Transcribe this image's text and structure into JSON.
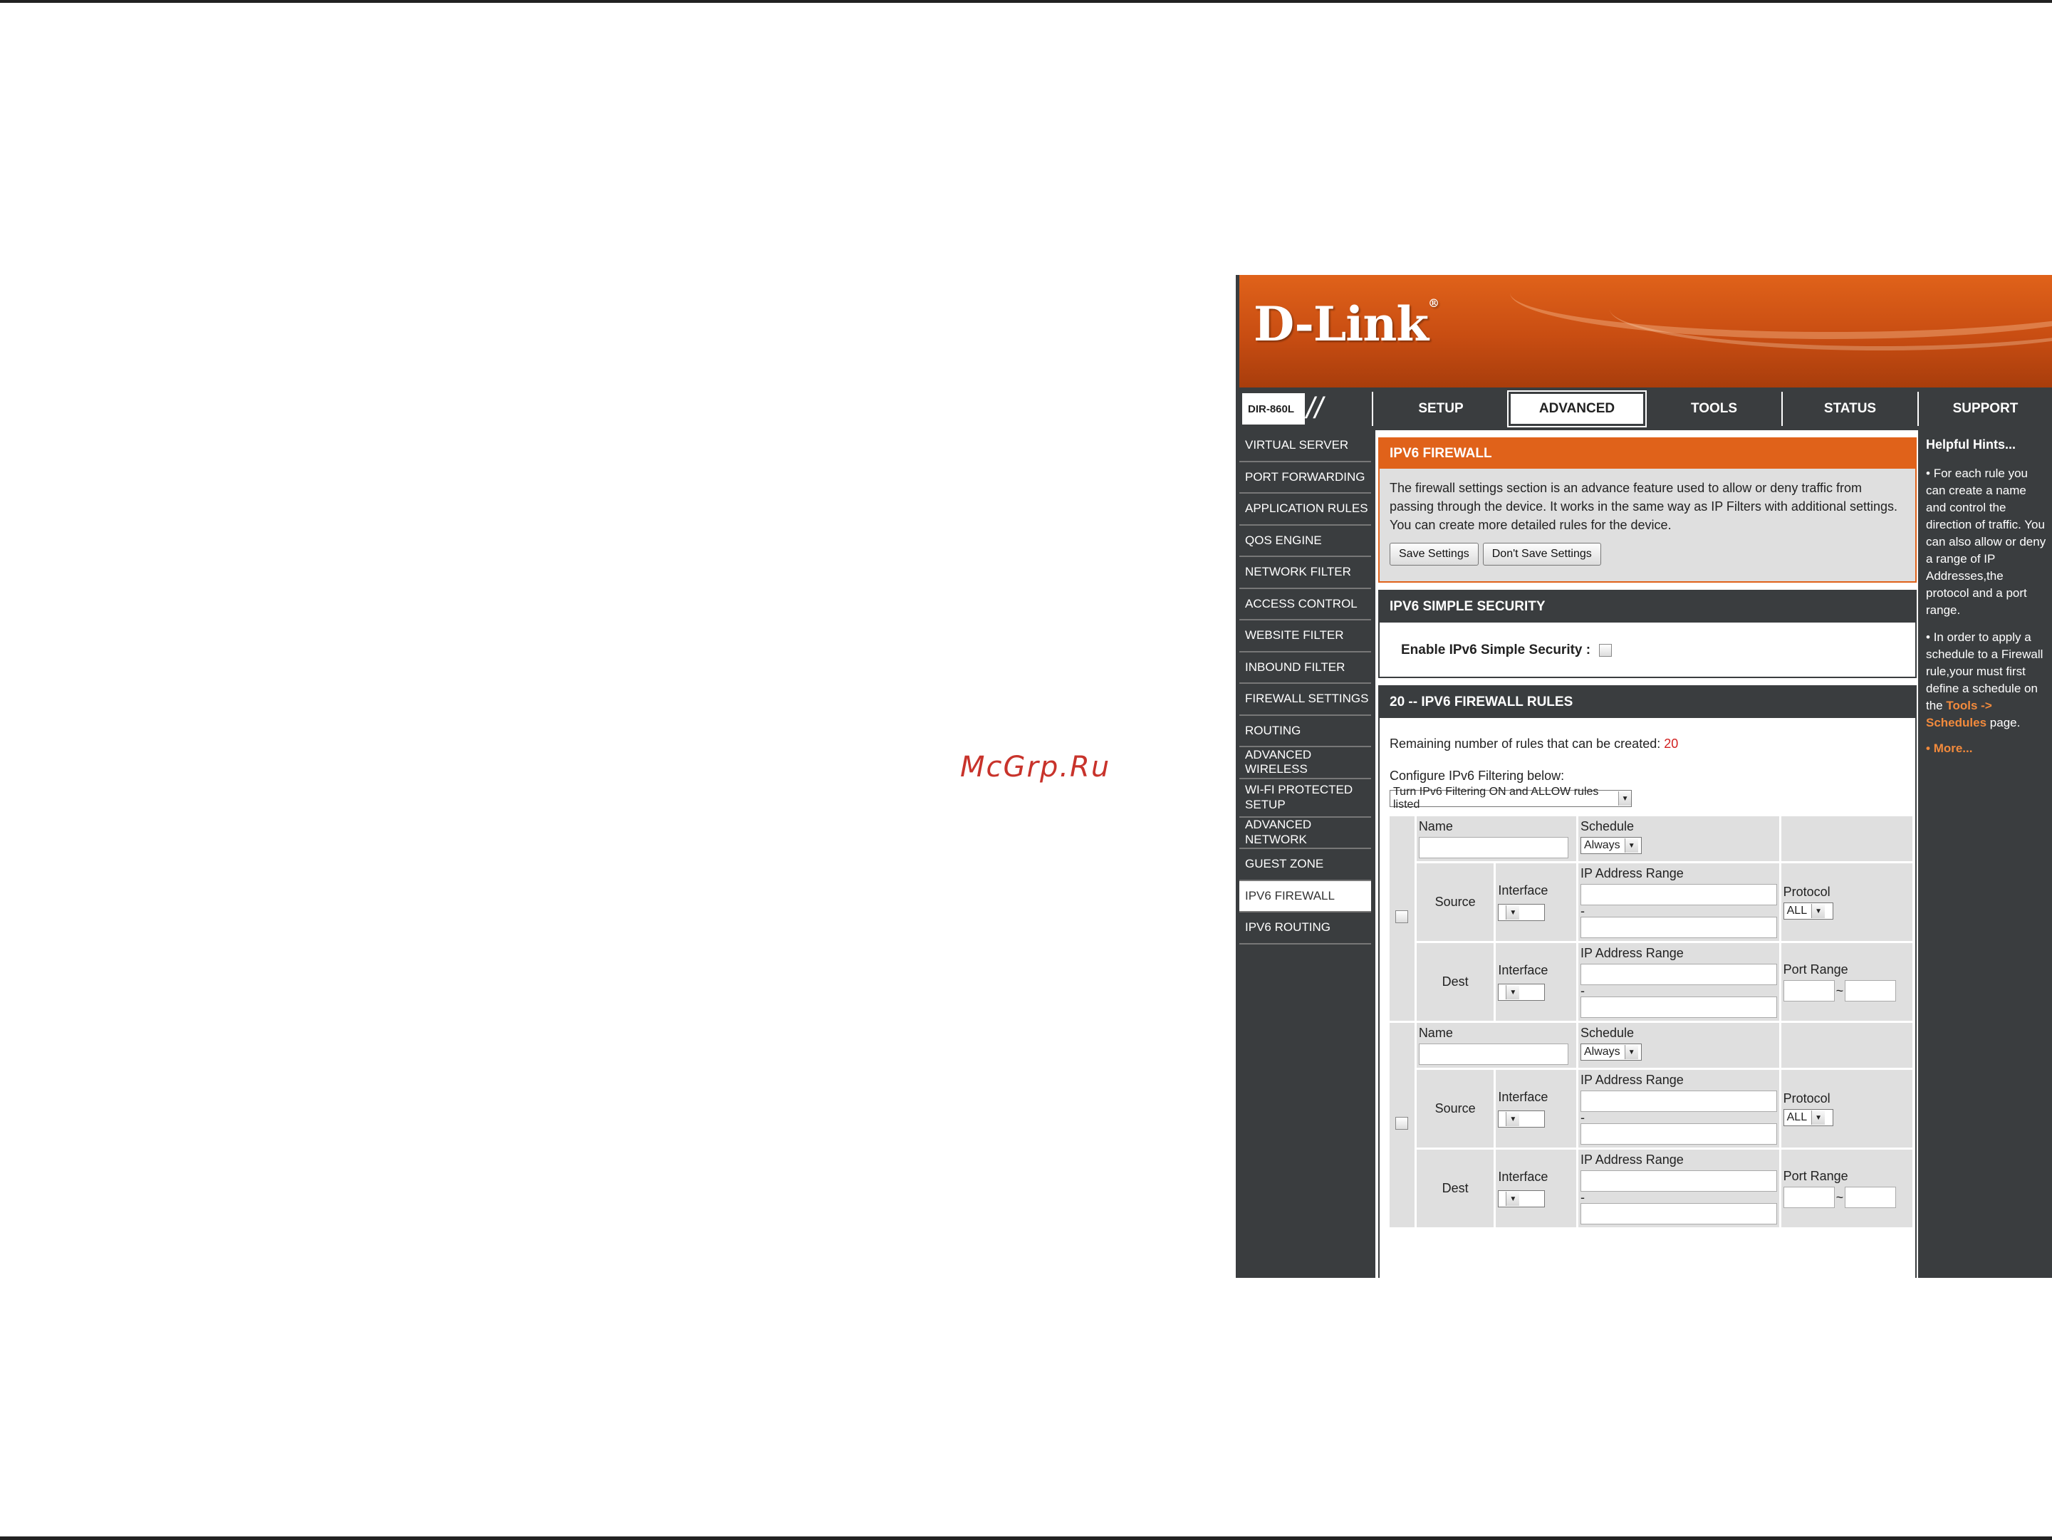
{
  "watermark": "McGrp.Ru",
  "brand": {
    "logo": "D-Link",
    "registered": "®",
    "model": "DIR-860L",
    "accent": "#e0621a"
  },
  "nav": {
    "tabs": [
      "SETUP",
      "ADVANCED",
      "TOOLS",
      "STATUS",
      "SUPPORT"
    ],
    "active": "ADVANCED"
  },
  "sidebar": {
    "items": [
      "VIRTUAL SERVER",
      "PORT FORWARDING",
      "APPLICATION RULES",
      "QOS ENGINE",
      "NETWORK FILTER",
      "ACCESS CONTROL",
      "WEBSITE FILTER",
      "INBOUND FILTER",
      "FIREWALL SETTINGS",
      "ROUTING",
      "ADVANCED WIRELESS",
      "WI-FI PROTECTED SETUP",
      "ADVANCED NETWORK",
      "GUEST ZONE",
      "IPV6 FIREWALL",
      "IPV6 ROUTING"
    ],
    "active": "IPV6 FIREWALL"
  },
  "firewall": {
    "title": "IPV6 FIREWALL",
    "description": "The firewall settings section is an advance feature used to allow or deny traffic from passing through the device. It works in the same way as IP Filters with additional settings. You can create more detailed rules for the device.",
    "save_label": "Save Settings",
    "dont_save_label": "Don't Save Settings"
  },
  "simple_security": {
    "title": "IPV6 SIMPLE SECURITY",
    "label": "Enable IPv6 Simple Security :",
    "checked": false
  },
  "rules": {
    "title": "20 -- IPV6 FIREWALL RULES",
    "remaining_label": "Remaining number of rules that can be created:",
    "remaining_value": "20",
    "configure_label": "Configure IPv6 Filtering below:",
    "configure_value": "Turn IPv6 Filtering ON and ALLOW rules listed",
    "labels": {
      "name": "Name",
      "schedule": "Schedule",
      "source": "Source",
      "dest": "Dest",
      "interface": "Interface",
      "ip_range": "IP Address Range",
      "protocol": "Protocol",
      "port_range": "Port Range",
      "dash": "-",
      "tilde": "~"
    },
    "schedule_value": "Always",
    "protocol_value": "ALL"
  },
  "hints": {
    "title": "Helpful Hints...",
    "hint1": "For each rule you can create a name and control the direction of traffic. You can also allow or deny a range of IP Addresses,the protocol and a port range.",
    "hint2_text": "In order to apply a schedule to a Firewall rule,your must first define a schedule on the",
    "hint2_link": "Tools -> Schedules",
    "hint2_after": "page.",
    "more": "More..."
  }
}
